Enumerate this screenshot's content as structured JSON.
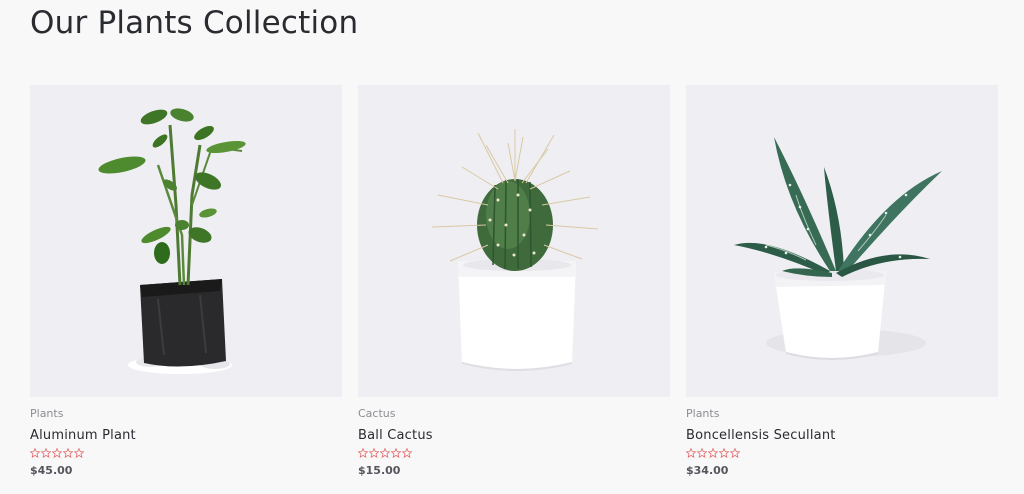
{
  "page": {
    "title": "Our Plants Collection"
  },
  "products": [
    {
      "category": "Plants",
      "name": "Aluminum Plant",
      "price": "$45.00",
      "rating": 0,
      "image_icon": "potted-seedling-image"
    },
    {
      "category": "Cactus",
      "name": "Ball Cactus",
      "price": "$15.00",
      "rating": 0,
      "image_icon": "ball-cactus-image"
    },
    {
      "category": "Plants",
      "name": "Boncellensis Secullant",
      "price": "$34.00",
      "rating": 0,
      "image_icon": "succulent-pot-image"
    }
  ],
  "colors": {
    "background": "#f8f8f9",
    "image_background": "#efeff3",
    "star_outline": "#e36b6b",
    "title_text": "#2a2b30",
    "category_text": "#8c8d92"
  }
}
